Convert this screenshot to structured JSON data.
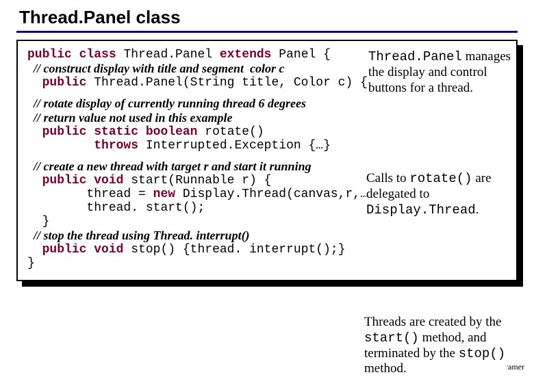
{
  "heading": "Thread.Panel class",
  "lines": {
    "l01a": "public",
    "l01b": " ",
    "l01c": "class",
    "l01d": " Thread.Panel ",
    "l01e": "extends",
    "l01f": " Panel {",
    "c01": "  // construct display with title and segment  color c",
    "l02a": "  public",
    "l02b": " Thread.Panel(String title, Color c) {…}",
    "c02": "  // rotate display of currently running thread 6 degrees",
    "c03": "  // return value not used in this example",
    "l03a": "  public",
    "l03b": " ",
    "l03c": "static",
    "l03d": " ",
    "l03e": "boolean",
    "l03f": " rotate()",
    "l04a": "         throws",
    "l04b": " Interrupted.Exception {…}",
    "c04": "  // create a new thread with target r and start it running",
    "l05a": "  public",
    "l05b": " ",
    "l05c": "void",
    "l05d": " start(Runnable r) {",
    "l06a": "        thread = ",
    "l06b": "new",
    "l06c": " Display.Thread(canvas,r,…);",
    "l07": "        thread. start();",
    "l08": "  }",
    "c05": "  // stop the thread using Thread. interrupt()",
    "l09a": "  public",
    "l09b": " ",
    "l09c": "void",
    "l09d": " stop() {thread. interrupt();}",
    "l10": "}"
  },
  "annotations": {
    "a1_code": "Thread.Panel",
    "a1_rest": " manages the display and control buttons for a thread.",
    "a2_pre": "Calls to ",
    "a2_code1": "rotate()",
    "a2_mid": " are delegated to ",
    "a2_code2": "Display.Thread",
    "a2_post": ".",
    "a3_pre": "Threads are created by the ",
    "a3_code1": "start()",
    "a3_mid": " method, and terminated by the ",
    "a3_code2": "stop()",
    "a3_post": " method."
  },
  "copyright": "©Magee/Kramer"
}
